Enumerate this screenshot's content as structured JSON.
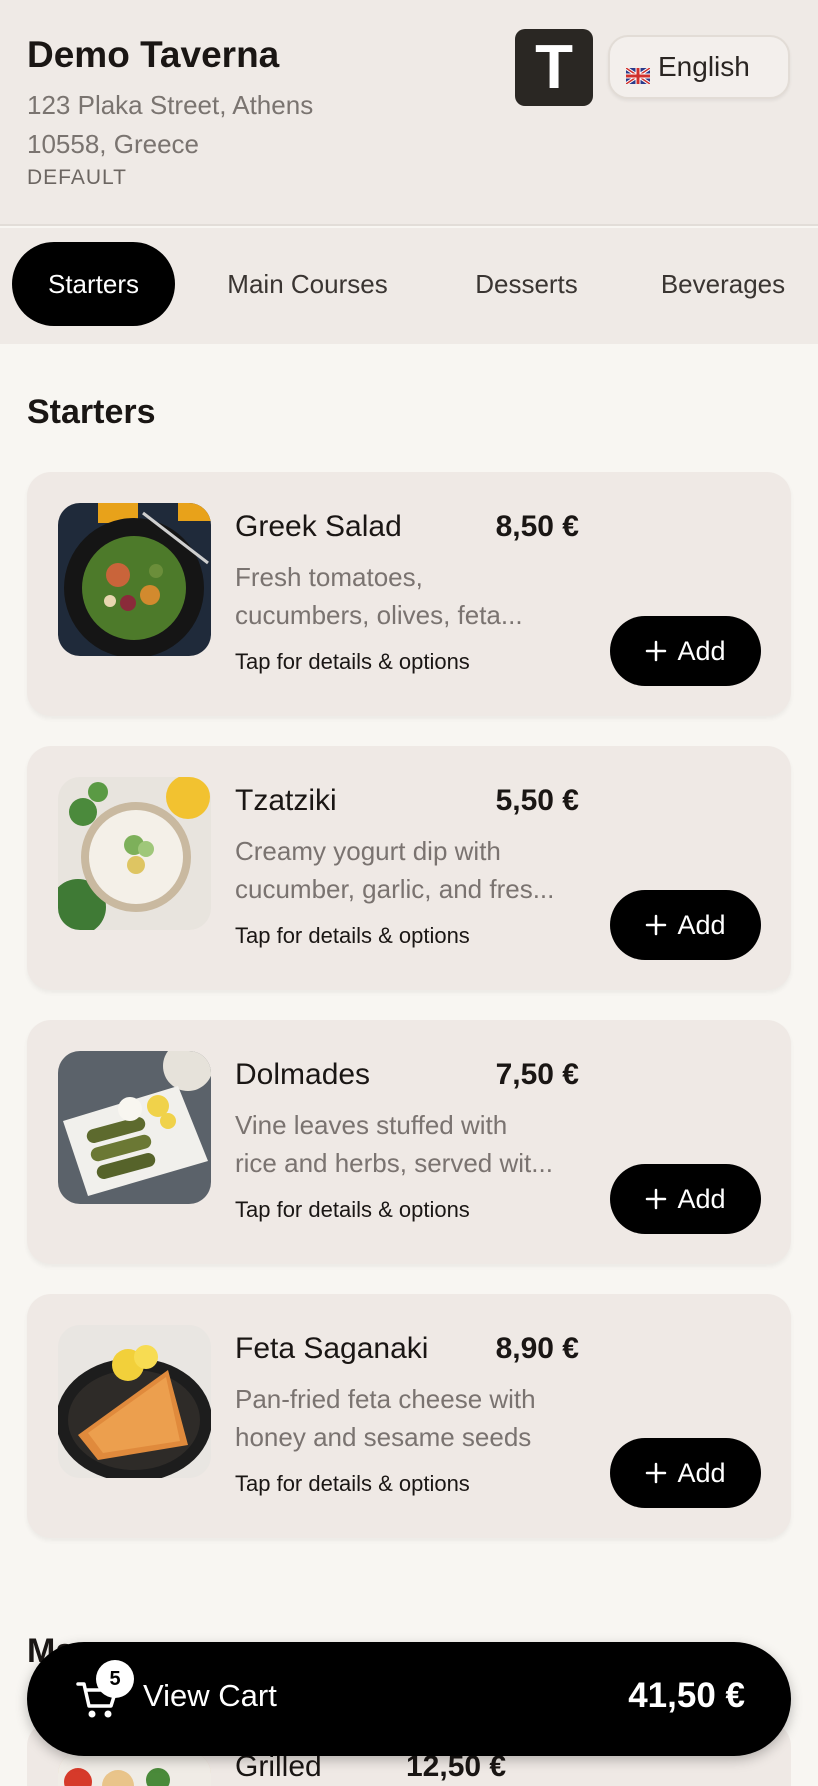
{
  "restaurant": {
    "name": "Demo Taverna",
    "address_line1": "123 Plaka Street, Athens",
    "address_line2": "10558, Greece",
    "tag": "DEFAULT",
    "logo_letter": "T"
  },
  "language": {
    "label": "English",
    "flag": "uk-flag-icon"
  },
  "tabs": [
    {
      "label": "Starters",
      "active": true
    },
    {
      "label": "Main Courses",
      "active": false
    },
    {
      "label": "Desserts",
      "active": false
    },
    {
      "label": "Beverages",
      "active": false
    }
  ],
  "section": {
    "title": "Starters"
  },
  "items": [
    {
      "name": "Greek Salad",
      "price": "8,50 €",
      "desc_line1": "Fresh tomatoes,",
      "desc_line2": "cucumbers, olives, feta...",
      "hint": "Tap for details & options",
      "add_label": "Add"
    },
    {
      "name": "Tzatziki",
      "price": "5,50 €",
      "desc_line1": "Creamy yogurt dip with",
      "desc_line2": "cucumber, garlic, and fres...",
      "hint": "Tap for details & options",
      "add_label": "Add"
    },
    {
      "name": "Dolmades",
      "price": "7,50 €",
      "desc_line1": "Vine leaves stuffed with",
      "desc_line2": "rice and herbs, served wit...",
      "hint": "Tap for details & options",
      "add_label": "Add"
    },
    {
      "name": "Feta Saganaki",
      "price": "8,90 €",
      "desc_line1": "Pan-fried feta cheese with",
      "desc_line2": "honey and sesame seeds",
      "hint": "Tap for details & options",
      "add_label": "Add"
    }
  ],
  "next_section": {
    "title_partial": "Ma",
    "item_name": "Grilled",
    "item_price": "12,50 €"
  },
  "cart": {
    "count": "5",
    "label": "View Cart",
    "total": "41,50 €"
  },
  "colors": {
    "accent": "#000000",
    "header_bg": "#efeae6",
    "page_bg": "#f8f6f2",
    "card_bg": "#efe9e5"
  }
}
